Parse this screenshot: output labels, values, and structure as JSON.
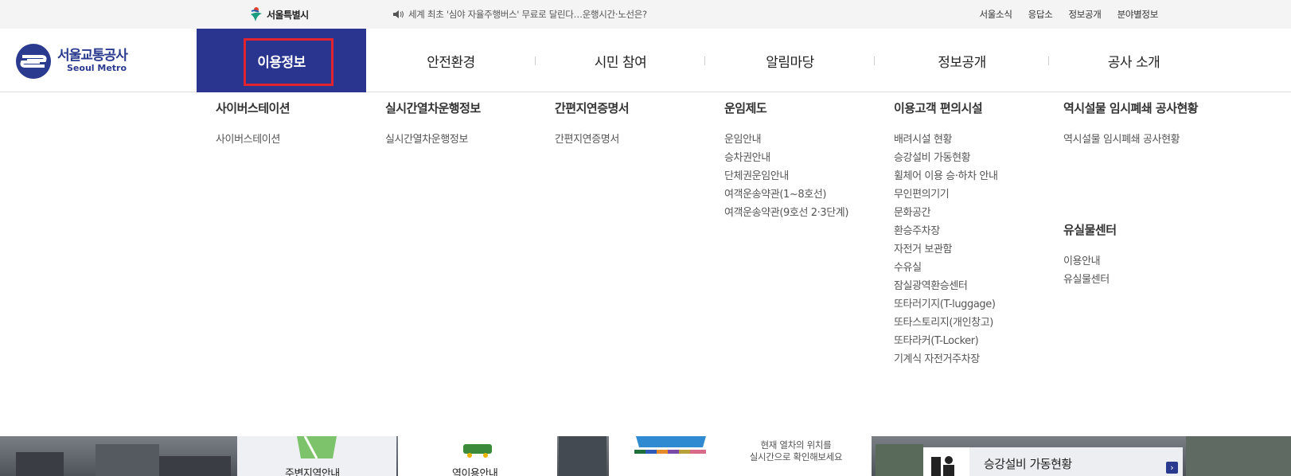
{
  "topbar": {
    "city_logo_text": "서울특별시",
    "news_text": "세계 최초 '심야 자율주행버스' 무료로 달린다…운행시간·노선은?",
    "util_links": [
      "서울소식",
      "응답소",
      "정보공개",
      "분야별정보"
    ]
  },
  "brand": {
    "name_ko": "서울교통공사",
    "name_en": "Seoul Metro"
  },
  "gnb": {
    "tabs": [
      "이용정보",
      "안전환경",
      "시민 참여",
      "알림마당",
      "정보공개",
      "공사 소개"
    ],
    "active_index": 0
  },
  "mega": {
    "columns": [
      {
        "title": "사이버스테이션",
        "items": [
          "사이버스테이션"
        ]
      },
      {
        "title": "실시간열차운행정보",
        "items": [
          "실시간열차운행정보"
        ]
      },
      {
        "title": "간편지연증명서",
        "items": [
          "간편지연증명서"
        ]
      },
      {
        "title": "운임제도",
        "items": [
          "운임안내",
          "승차권안내",
          "단체권운임안내",
          "여객운송약관(1~8호선)",
          "여객운송약관(9호선 2·3단계)"
        ]
      },
      {
        "title": "이용고객 편의시설",
        "items": [
          "배려시설 현황",
          "승강설비 가동현황",
          "휠체어 이용 승·하차 안내",
          "무인편의기기",
          "문화공간",
          "환승주차장",
          "자전거 보관함",
          "수유실",
          "잠실광역환승센터",
          "또타러기지(T-luggage)",
          "또타스토리지(개인창고)",
          "또타라커(T-Locker)",
          "기계식 자전거주차장"
        ]
      },
      {
        "title": "역시설물 임시폐쇄 공사현황",
        "items": [
          "역시설물 임시폐쇄 공사현황"
        ]
      }
    ],
    "extra_group": {
      "title": "유실물센터",
      "items": [
        "이용안내",
        "유실물센터"
      ]
    }
  },
  "bottom": {
    "card1_label": "주변지역안내",
    "card2_label": "역이용안내",
    "realtime_text_1": "현재 열차의 위치를",
    "realtime_text_2": "실시간으로 확인해보세요",
    "facility_label": "승강설비 가동현황",
    "arrow_glyph": "›"
  },
  "colors": {
    "brand_navy": "#2a3590",
    "highlight_red": "#e0232e"
  }
}
